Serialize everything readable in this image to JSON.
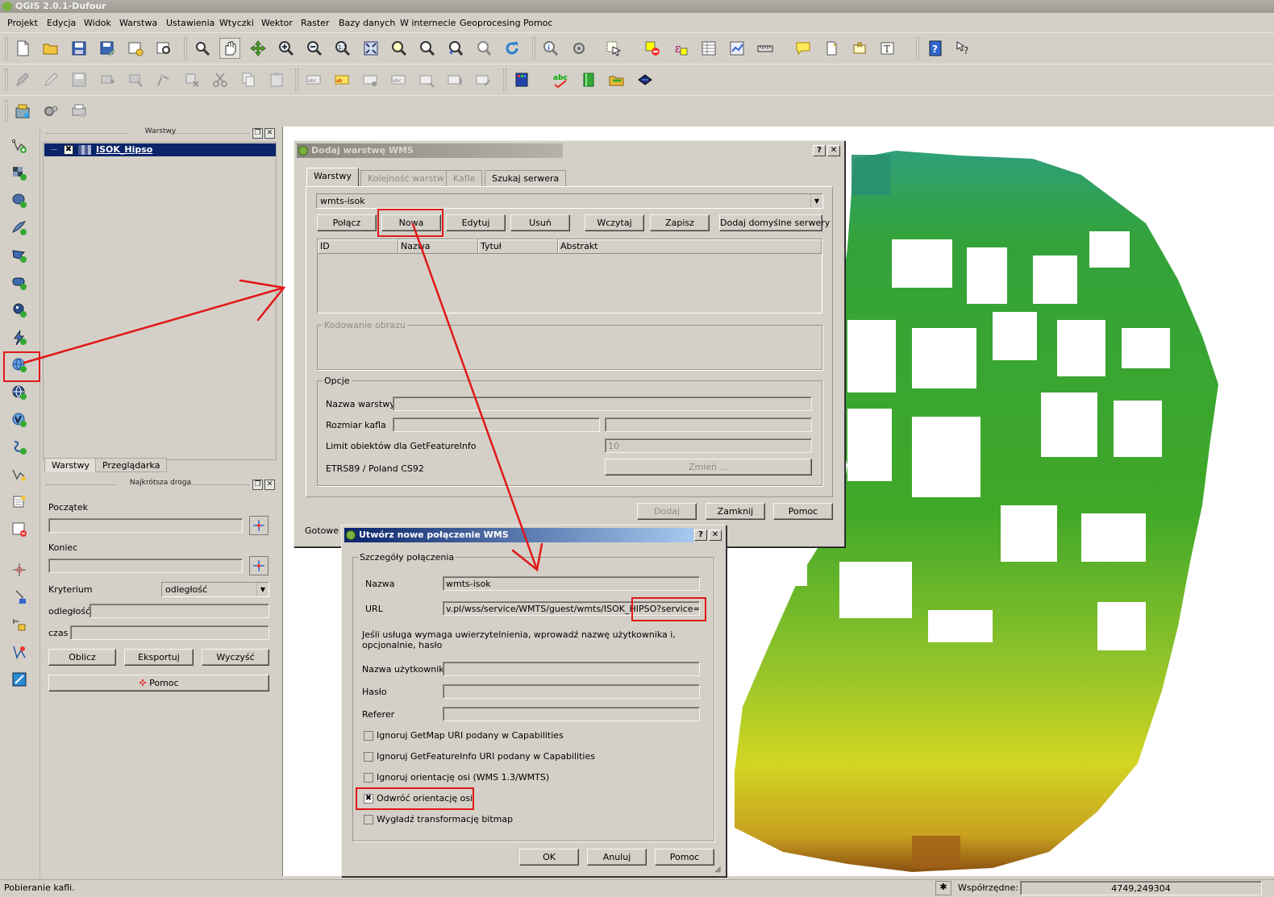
{
  "window": {
    "title": "QGIS 2.0.1-Dufour"
  },
  "menu": [
    "Projekt",
    "Edycja",
    "Widok",
    "Warstwa",
    "Ustawienia",
    "Wtyczki",
    "Wektor",
    "Raster",
    "Bazy danych",
    "W internecie",
    "Geoprocesing",
    "Pomoc"
  ],
  "layers_panel": {
    "title": "Warstwy",
    "layer": {
      "name": "ISOK_Hipso",
      "checked": "✖"
    },
    "tabs": [
      "Warstwy",
      "Przeglądarka"
    ]
  },
  "route_panel": {
    "title": "Najkrótsza droga",
    "start_label": "Początek",
    "end_label": "Koniec",
    "criterion_label": "Kryterium",
    "criterion_value": "odległość",
    "distance_label": "odległość",
    "time_label": "czas",
    "buttons": {
      "calc": "Oblicz",
      "export": "Eksportuj",
      "clear": "Wyczyść",
      "help": "Pomoc"
    }
  },
  "wms_dialog": {
    "title": "Dodaj warstwę WMS",
    "tabs": [
      "Warstwy",
      "Kolejność warstw",
      "Kafle",
      "Szukaj serwera"
    ],
    "connection": "wmts-isok",
    "buttons": {
      "connect": "Połącz",
      "new": "Nowa",
      "edit": "Edytuj",
      "delete": "Usuń",
      "load": "Wczytaj",
      "save": "Zapisz",
      "add_default": "Dodaj domyślne serwery"
    },
    "table_headers": [
      "ID",
      "Nazwa",
      "Tytuł",
      "Abstrakt"
    ],
    "image_encoding_group": "Kodowanie obrazu",
    "options_group": "Opcje",
    "layer_name_label": "Nazwa warstwy",
    "tile_size_label": "Rozmiar kafla",
    "feature_limit_label": "Limit obiektów dla GetFeatureInfo",
    "feature_limit_value": "10",
    "crs_label": "ETRS89 / Poland CS92",
    "change_button": "Zmień ...",
    "footer_buttons": {
      "add": "Dodaj",
      "close": "Zamknij",
      "help": "Pomoc"
    },
    "status": "Gotowe"
  },
  "new_conn_dialog": {
    "title": "Utwórz nowe połączenie WMS",
    "group_title": "Szczegóły połączenia",
    "name_label": "Nazwa",
    "name_value": "wmts-isok",
    "url_label": "URL",
    "url_value": "v.pl/wss/service/WMTS/guest/wmts/ISOK_HIPSO?service=WMTS",
    "auth_note": "Jeśli usługa wymaga uwierzytelnienia, wprowadź nazwę użytkownika i, opcjonalnie, hasło",
    "user_label": "Nazwa użytkownika",
    "password_label": "Hasło",
    "referer_label": "Referer",
    "checks": [
      {
        "label": "Ignoruj GetMap URI podany w Capabilities",
        "mark": ""
      },
      {
        "label": "Ignoruj GetFeatureInfo URI podany w Capabilities",
        "mark": ""
      },
      {
        "label": "Ignoruj orientację osi (WMS 1.3/WMTS)",
        "mark": ""
      },
      {
        "label": "Odwróć orientację osi",
        "mark": "✖"
      },
      {
        "label": "Wygładź transformację bitmap",
        "mark": ""
      }
    ],
    "buttons": {
      "ok": "OK",
      "cancel": "Anuluj",
      "help": "Pomoc"
    }
  },
  "statusbar": {
    "message": "Pobieranie kafli.",
    "coords_label": "Współrzędne:",
    "coords_value": "4749,249304"
  },
  "colors": {
    "highlight": "#e01818",
    "selection": "#0a246a",
    "map_green": "#3aa02a",
    "map_yellow": "#d8d81a"
  }
}
